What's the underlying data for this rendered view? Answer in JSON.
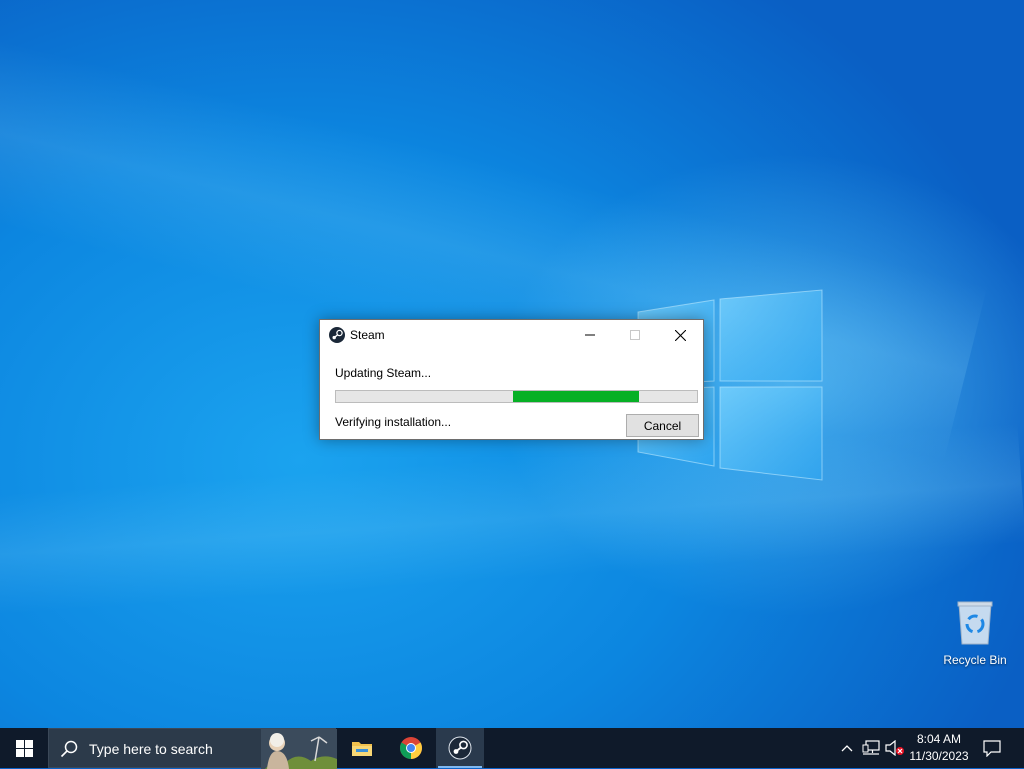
{
  "desktop": {
    "icons": [
      {
        "label": "Recycle Bin",
        "icon": "recycle-bin-icon"
      }
    ]
  },
  "dialog": {
    "title": "Steam",
    "app_icon": "steam-icon",
    "status_text": "Updating Steam...",
    "detail_text": "Verifying installation...",
    "progress": {
      "segment_start": 0.49,
      "segment_end": 0.84,
      "color": "#06b025"
    },
    "cancel_label": "Cancel",
    "controls": [
      "minimize-icon",
      "maximize-icon",
      "close-icon"
    ]
  },
  "taskbar": {
    "start_icon": "windows-logo-icon",
    "search_placeholder": "Type here to search",
    "pinned_apps": [
      {
        "name": "File Explorer",
        "icon": "folder-icon"
      },
      {
        "name": "Google Chrome",
        "icon": "chrome-icon"
      },
      {
        "name": "Steam",
        "icon": "steam-icon",
        "active": true
      }
    ],
    "tray": {
      "icons": [
        "chevron-up-icon",
        "network-icon",
        "volume-muted-icon"
      ],
      "time": "8:04 AM",
      "date": "11/30/2023",
      "notification_icon": "notification-icon"
    }
  },
  "colors": {
    "wallpaper": "#0c86e0",
    "taskbar": "#0f1a2a",
    "progress_green": "#06b025"
  }
}
